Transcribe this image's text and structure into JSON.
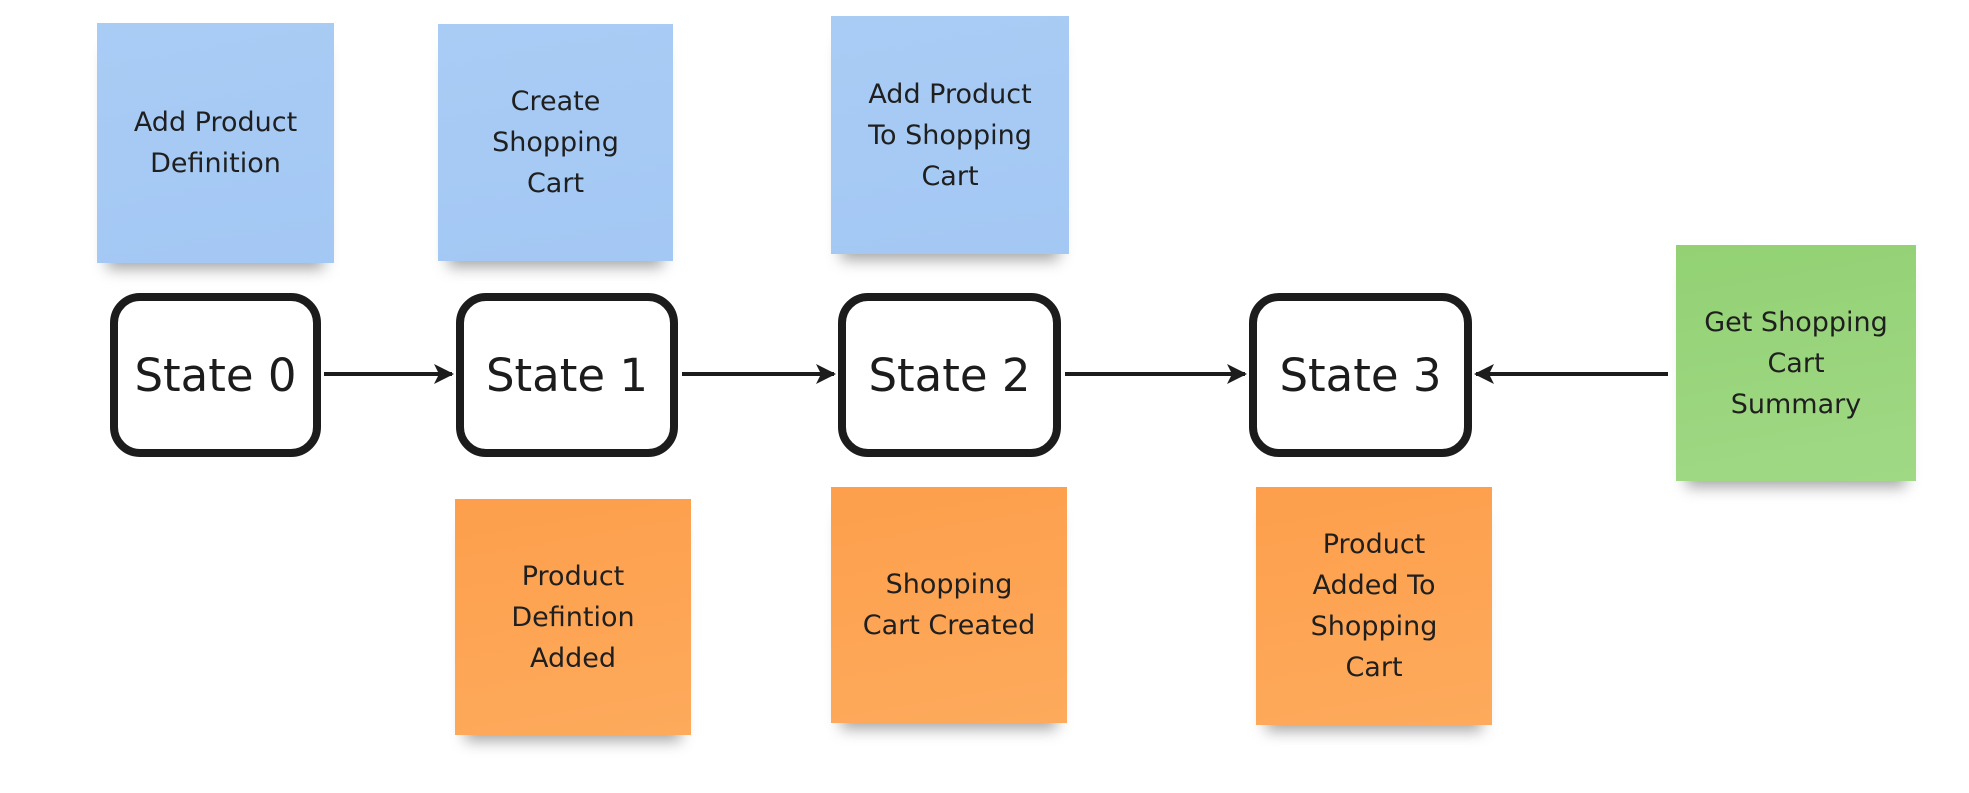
{
  "commands": [
    {
      "label": "Add Product Definition"
    },
    {
      "label": "Create Shopping Cart"
    },
    {
      "label": "Add Product To Shopping Cart"
    }
  ],
  "query": {
    "label": "Get Shopping Cart Summary"
  },
  "events": [
    {
      "label": "Product Defintion Added"
    },
    {
      "label": "Shopping Cart Created"
    },
    {
      "label": "Product Added To Shopping Cart"
    }
  ],
  "states": [
    {
      "label": "State 0"
    },
    {
      "label": "State 1"
    },
    {
      "label": "State 2"
    },
    {
      "label": "State 3"
    }
  ],
  "colors": {
    "command": "#a9ccf5",
    "event": "#fda24e",
    "query": "#96d47a",
    "stroke": "#1c1c1c"
  }
}
